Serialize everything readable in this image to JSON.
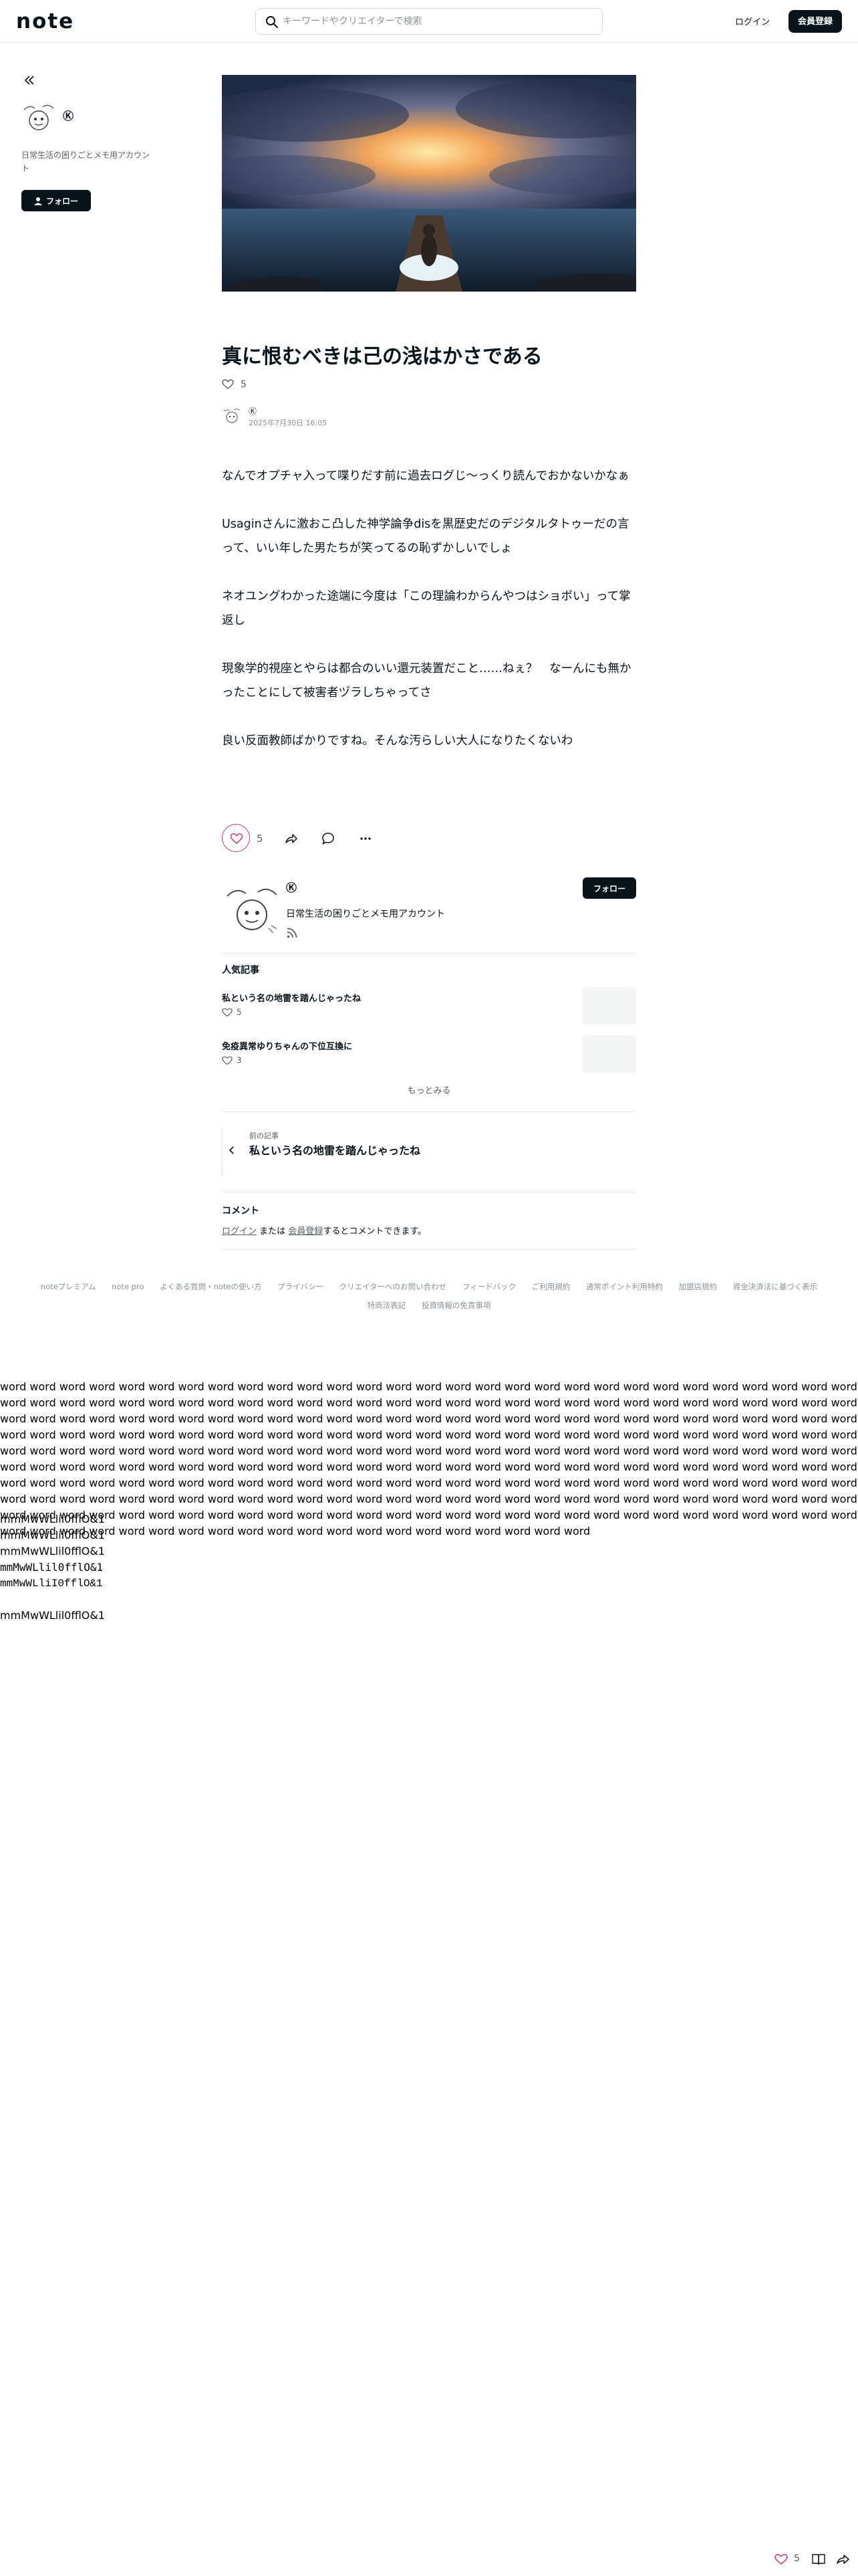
{
  "header": {
    "logo": "note",
    "search_placeholder": "キーワードやクリエイターで検索",
    "login_label": "ログイン",
    "signup_label": "会員登録"
  },
  "sidebar": {
    "creator_name": "Ⓚ",
    "creator_desc": "日常生活の困りごとメモ用アカウント",
    "follow_label": "フォロー"
  },
  "article": {
    "title": "真に恨むべきは己の浅はかさである",
    "like_count": "5",
    "author_name": "Ⓚ",
    "date": "2025年7月30日 16:05",
    "paragraphs": [
      "なんでオプチャ入って喋りだす前に過去ログじ〜っくり読んでおかないかなぁ",
      "Usaginさんに激おこ凸した神学論争disを黒歴史だのデジタルタトゥーだの言って、いい年した男たちが笑ってるの恥ずかしいでしょ",
      "ネオユングわかった途端に今度は「この理論わからんやつはショボい」って掌返し",
      "現象学的視座とやらは都合のいい還元装置だこと……ねぇ？　なーんにも無かったことにして被害者ヅラしちゃってさ",
      "良い反面教師ばかりですね。そんな汚らしい大人になりたくないわ"
    ]
  },
  "actions": {
    "like_count": "5"
  },
  "creator_card": {
    "name": "Ⓚ",
    "desc": "日常生活の困りごとメモ用アカウント",
    "follow_label": "フォロー"
  },
  "popular": {
    "heading": "人気記事",
    "items": [
      {
        "title": "私という名の地雷を踏んじゃったね",
        "likes": "5"
      },
      {
        "title": "免疫異常ゆりちゃんの下位互換に",
        "likes": "3"
      }
    ],
    "more_label": "もっとみる"
  },
  "prev": {
    "label": "前の記事",
    "title": "私という名の地雷を踏んじゃったね"
  },
  "comments": {
    "heading": "コメント",
    "login_link": "ログイン",
    "or_text": "または",
    "signup_link": "会員登録",
    "suffix": "するとコメントできます。"
  },
  "footer": {
    "links": [
      "noteプレミアム",
      "note pro",
      "よくある質問・noteの使い方",
      "プライバシー",
      "クリエイターへのお問い合わせ",
      "フィードバック",
      "ご利用規約",
      "通常ポイント利用特約",
      "加盟店規約",
      "資金決済法に基づく表示",
      "特商法表記",
      "投資情報の免責事項"
    ]
  },
  "filler": {
    "words": "word word word word word word word word word word word word word word word word word word word word word word word word word word word word word word word word word word word word word word word word word word word word word word word word word word word word word word word word word word word word word word word word word word word word word word word word word word word word word word word word word word word word word word word word word word word word word word word word word word word word word word word word word word word word word word word word word word word word word word word word word word word word word word word word word word word word word word word word word word word word word word word word word word word word word word word word word word word word word word word word word word word word word word word word word word word word word word word word word word word word word word word word word word word word word word word word word word word word word word word word word word word word word word word word word word word word word word word word word word word word word word word word word word word word word word word word word word word word word word word word word word word word word word word word word word word word word word word word word word word word word word word word word word word word word word word word word word word word word word word word word",
    "glyph_lines": [
      "mmMwWLlil0fflO&1",
      "mmMwWLlil0fflO&1",
      "mmMwWLlil0fflO&1",
      "mmMwWLlil0fflO&1",
      "mmMwWLliI0fflO&1",
      "",
      "mmMwWLlil0fflO&1"
    ]
  },
  "float_bar": {
    "like_count": "5"
  },
  "colors": {
    "ink": "#08131a",
    "muted": "#5a6166",
    "like_accent": "#c94467",
    "divider": "#e6e6e6"
  }
}
